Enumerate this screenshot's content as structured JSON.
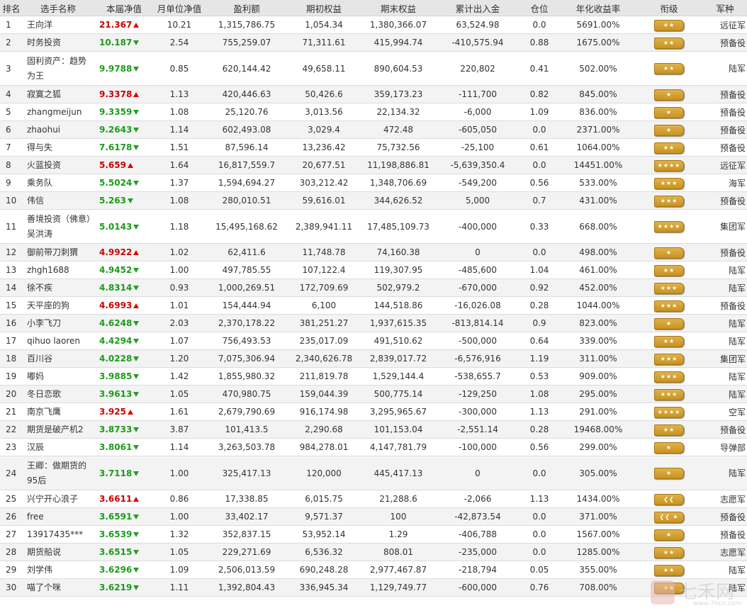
{
  "headers": [
    "排名",
    "选手名称",
    "本届净值",
    "月单位净值",
    "盈利额",
    "期初权益",
    "期末权益",
    "累计出入金",
    "仓位",
    "年化收益率",
    "衔级",
    "军种"
  ],
  "rows": [
    {
      "rank": "1",
      "name": "王向洋",
      "nav": "21.367",
      "dir": "up",
      "monthly": "10.21",
      "profit": "1,315,786.75",
      "start": "1,054.34",
      "end": "1,380,366.07",
      "flow": "63,524.98",
      "position": "0.0",
      "annual": "5691.00%",
      "rank_icon": "two-star-badge",
      "army": "远征军"
    },
    {
      "rank": "2",
      "name": "时务投资",
      "nav": "10.187",
      "dir": "down",
      "monthly": "2.54",
      "profit": "755,259.07",
      "start": "71,311.61",
      "end": "415,994.74",
      "flow": "-410,575.94",
      "position": "0.88",
      "annual": "1675.00%",
      "rank_icon": "two-star-badge",
      "army": "预备役"
    },
    {
      "rank": "3",
      "name": "固利资产：趋势为王",
      "nav": "9.9788",
      "dir": "down",
      "monthly": "0.85",
      "profit": "620,144.42",
      "start": "49,658.11",
      "end": "890,604.53",
      "flow": "220,802",
      "position": "0.41",
      "annual": "502.00%",
      "rank_icon": "two-star-badge",
      "army": "陆军"
    },
    {
      "rank": "4",
      "name": "寂寞之狐",
      "nav": "9.3378",
      "dir": "up",
      "monthly": "1.13",
      "profit": "420,446.63",
      "start": "50,426.6",
      "end": "359,173.23",
      "flow": "-111,700",
      "position": "0.82",
      "annual": "845.00%",
      "rank_icon": "one-star-badge",
      "army": "预备役"
    },
    {
      "rank": "5",
      "name": "zhangmeijun",
      "nav": "9.3359",
      "dir": "down",
      "monthly": "1.08",
      "profit": "25,120.76",
      "start": "3,013.56",
      "end": "22,134.32",
      "flow": "-6,000",
      "position": "1.09",
      "annual": "836.00%",
      "rank_icon": "one-star-badge",
      "army": "预备役"
    },
    {
      "rank": "6",
      "name": "zhaohui",
      "nav": "9.2643",
      "dir": "down",
      "monthly": "1.14",
      "profit": "602,493.08",
      "start": "3,029.4",
      "end": "472.48",
      "flow": "-605,050",
      "position": "0.0",
      "annual": "2371.00%",
      "rank_icon": "one-star-badge",
      "army": "预备役"
    },
    {
      "rank": "7",
      "name": "得与失",
      "nav": "7.6178",
      "dir": "down",
      "monthly": "1.51",
      "profit": "87,596.14",
      "start": "13,236.42",
      "end": "75,732.56",
      "flow": "-25,100",
      "position": "0.61",
      "annual": "1064.00%",
      "rank_icon": "two-star-badge",
      "army": "预备役"
    },
    {
      "rank": "8",
      "name": "火蓝投资",
      "nav": "5.659",
      "dir": "up",
      "monthly": "1.64",
      "profit": "16,817,559.7",
      "start": "20,677.51",
      "end": "11,198,886.81",
      "flow": "-5,639,350.4",
      "position": "0.0",
      "annual": "14451.00%",
      "rank_icon": "four-star-badge",
      "army": "远征军"
    },
    {
      "rank": "9",
      "name": "乘务队",
      "nav": "5.5024",
      "dir": "down",
      "monthly": "1.37",
      "profit": "1,594,694.27",
      "start": "303,212.42",
      "end": "1,348,706.69",
      "flow": "-549,200",
      "position": "0.56",
      "annual": "533.00%",
      "rank_icon": "three-star-badge",
      "army": "海军"
    },
    {
      "rank": "10",
      "name": "伟信",
      "nav": "5.263",
      "dir": "down",
      "monthly": "1.08",
      "profit": "280,010.51",
      "start": "59,616.01",
      "end": "344,626.52",
      "flow": "5,000",
      "position": "0.7",
      "annual": "431.00%",
      "rank_icon": "three-star-badge",
      "army": "预备役"
    },
    {
      "rank": "11",
      "name": "善境投资（佛意）吴洪涛",
      "nav": "5.0143",
      "dir": "down",
      "monthly": "1.18",
      "profit": "15,495,168.62",
      "start": "2,389,941.11",
      "end": "17,485,109.73",
      "flow": "-400,000",
      "position": "0.33",
      "annual": "668.00%",
      "rank_icon": "four-star-badge",
      "army": "集团军"
    },
    {
      "rank": "12",
      "name": "御前带刀刺猬",
      "nav": "4.9922",
      "dir": "up",
      "monthly": "1.02",
      "profit": "62,411.6",
      "start": "11,748.78",
      "end": "74,160.38",
      "flow": "0",
      "position": "0.0",
      "annual": "498.00%",
      "rank_icon": "one-star-badge",
      "army": "预备役"
    },
    {
      "rank": "13",
      "name": "zhgh1688",
      "nav": "4.9452",
      "dir": "down",
      "monthly": "1.00",
      "profit": "497,785.55",
      "start": "107,122.4",
      "end": "119,307.95",
      "flow": "-485,600",
      "position": "1.04",
      "annual": "461.00%",
      "rank_icon": "two-star-badge",
      "army": "陆军"
    },
    {
      "rank": "14",
      "name": "徐不疾",
      "nav": "4.8314",
      "dir": "down",
      "monthly": "0.93",
      "profit": "1,000,269.51",
      "start": "172,709.69",
      "end": "502,979.2",
      "flow": "-670,000",
      "position": "0.92",
      "annual": "452.00%",
      "rank_icon": "three-star-badge",
      "army": "陆军"
    },
    {
      "rank": "15",
      "name": "天平座的狗",
      "nav": "4.6993",
      "dir": "up",
      "monthly": "1.01",
      "profit": "154,444.94",
      "start": "6,100",
      "end": "144,518.86",
      "flow": "-16,026.08",
      "position": "0.28",
      "annual": "1044.00%",
      "rank_icon": "three-star-badge",
      "army": "预备役"
    },
    {
      "rank": "16",
      "name": "小李飞刀",
      "nav": "4.6248",
      "dir": "down",
      "monthly": "2.03",
      "profit": "2,370,178.22",
      "start": "381,251.27",
      "end": "1,937,615.35",
      "flow": "-813,814.14",
      "position": "0.9",
      "annual": "823.00%",
      "rank_icon": "one-star-badge",
      "army": "陆军"
    },
    {
      "rank": "17",
      "name": "qihuo laoren",
      "nav": "4.4294",
      "dir": "down",
      "monthly": "1.07",
      "profit": "756,493.53",
      "start": "235,017.09",
      "end": "491,510.62",
      "flow": "-500,000",
      "position": "0.64",
      "annual": "339.00%",
      "rank_icon": "two-star-badge",
      "army": "陆军"
    },
    {
      "rank": "18",
      "name": "百川谷",
      "nav": "4.0228",
      "dir": "down",
      "monthly": "1.20",
      "profit": "7,075,306.94",
      "start": "2,340,626.78",
      "end": "2,839,017.72",
      "flow": "-6,576,916",
      "position": "1.19",
      "annual": "311.00%",
      "rank_icon": "three-star-badge",
      "army": "集团军"
    },
    {
      "rank": "19",
      "name": "嘟妈",
      "nav": "3.9885",
      "dir": "down",
      "monthly": "1.42",
      "profit": "1,855,980.32",
      "start": "211,819.78",
      "end": "1,529,144.4",
      "flow": "-538,655.7",
      "position": "0.53",
      "annual": "909.00%",
      "rank_icon": "three-star-badge",
      "army": "陆军"
    },
    {
      "rank": "20",
      "name": "冬日恋歌",
      "nav": "3.9613",
      "dir": "down",
      "monthly": "1.05",
      "profit": "470,980.75",
      "start": "159,044.39",
      "end": "500,775.14",
      "flow": "-129,250",
      "position": "1.08",
      "annual": "295.00%",
      "rank_icon": "three-star-badge",
      "army": "陆军"
    },
    {
      "rank": "21",
      "name": "南京飞鹰",
      "nav": "3.925",
      "dir": "up",
      "monthly": "1.61",
      "profit": "2,679,790.69",
      "start": "916,174.98",
      "end": "3,295,965.67",
      "flow": "-300,000",
      "position": "1.13",
      "annual": "291.00%",
      "rank_icon": "four-star-badge",
      "army": "空军"
    },
    {
      "rank": "22",
      "name": "期货是破产机2",
      "nav": "3.8733",
      "dir": "down",
      "monthly": "3.87",
      "profit": "101,413.5",
      "start": "2,290.68",
      "end": "101,153.04",
      "flow": "-2,551.14",
      "position": "0.28",
      "annual": "19468.00%",
      "rank_icon": "two-star-badge",
      "army": "预备役"
    },
    {
      "rank": "23",
      "name": "汉辰",
      "nav": "3.8061",
      "dir": "down",
      "monthly": "1.14",
      "profit": "3,263,503.78",
      "start": "984,278.01",
      "end": "4,147,781.79",
      "flow": "-100,000",
      "position": "0.56",
      "annual": "299.00%",
      "rank_icon": "one-star-badge",
      "army": "导弹部"
    },
    {
      "rank": "24",
      "name": "王卿：做期货的95后",
      "nav": "3.7118",
      "dir": "down",
      "monthly": "1.00",
      "profit": "325,417.13",
      "start": "120,000",
      "end": "445,417.13",
      "flow": "0",
      "position": "0.0",
      "annual": "305.00%",
      "rank_icon": "one-star-badge",
      "army": "陆军"
    },
    {
      "rank": "25",
      "name": "兴宁开心浪子",
      "nav": "3.6611",
      "dir": "up",
      "monthly": "0.86",
      "profit": "17,338.85",
      "start": "6,015.75",
      "end": "21,288.6",
      "flow": "-2,066",
      "position": "1.13",
      "annual": "1434.00%",
      "rank_icon": "chevron-badge",
      "army": "志愿军"
    },
    {
      "rank": "26",
      "name": "free",
      "nav": "3.6591",
      "dir": "down",
      "monthly": "1.00",
      "profit": "33,402.17",
      "start": "9,571.37",
      "end": "100",
      "flow": "-42,873.54",
      "position": "0.0",
      "annual": "371.00%",
      "rank_icon": "chevron-star-badge",
      "army": "预备役"
    },
    {
      "rank": "27",
      "name": "13917435***",
      "nav": "3.6539",
      "dir": "down",
      "monthly": "1.32",
      "profit": "352,837.15",
      "start": "53,952.14",
      "end": "1.29",
      "flow": "-406,788",
      "position": "0.0",
      "annual": "1567.00%",
      "rank_icon": "one-star-badge",
      "army": "预备役"
    },
    {
      "rank": "28",
      "name": "期货船说",
      "nav": "3.6515",
      "dir": "down",
      "monthly": "1.05",
      "profit": "229,271.69",
      "start": "6,536.32",
      "end": "808.01",
      "flow": "-235,000",
      "position": "0.0",
      "annual": "1285.00%",
      "rank_icon": "two-star-badge",
      "army": "志愿军"
    },
    {
      "rank": "29",
      "name": "刘学伟",
      "nav": "3.6296",
      "dir": "down",
      "monthly": "1.09",
      "profit": "2,506,013.59",
      "start": "690,248.28",
      "end": "2,977,467.87",
      "flow": "-218,794",
      "position": "0.05",
      "annual": "355.00%",
      "rank_icon": "two-star-badge",
      "army": "陆军"
    },
    {
      "rank": "30",
      "name": "喵了个咪",
      "nav": "3.6219",
      "dir": "down",
      "monthly": "1.11",
      "profit": "1,392,804.43",
      "start": "336,945.34",
      "end": "1,129,749.77",
      "flow": "-600,000",
      "position": "0.76",
      "annual": "708.00%",
      "rank_icon": "two-star-badge",
      "army": "陆军"
    }
  ],
  "badges": {
    "one-star-badge": "★",
    "two-star-badge": "★★",
    "three-star-badge": "★★★",
    "four-star-badge": "★★★★",
    "chevron-badge": "❮❮",
    "chevron-star-badge": "❮❮ ★"
  },
  "watermark": {
    "text": "七禾网",
    "url": "www.7hcn.com"
  },
  "colors": {
    "up": "#cc0000",
    "down": "#1a9c1a",
    "header_bg": "#e6e6e6",
    "row_alt": "#f3f3f3",
    "badge": "#d9a53a"
  }
}
